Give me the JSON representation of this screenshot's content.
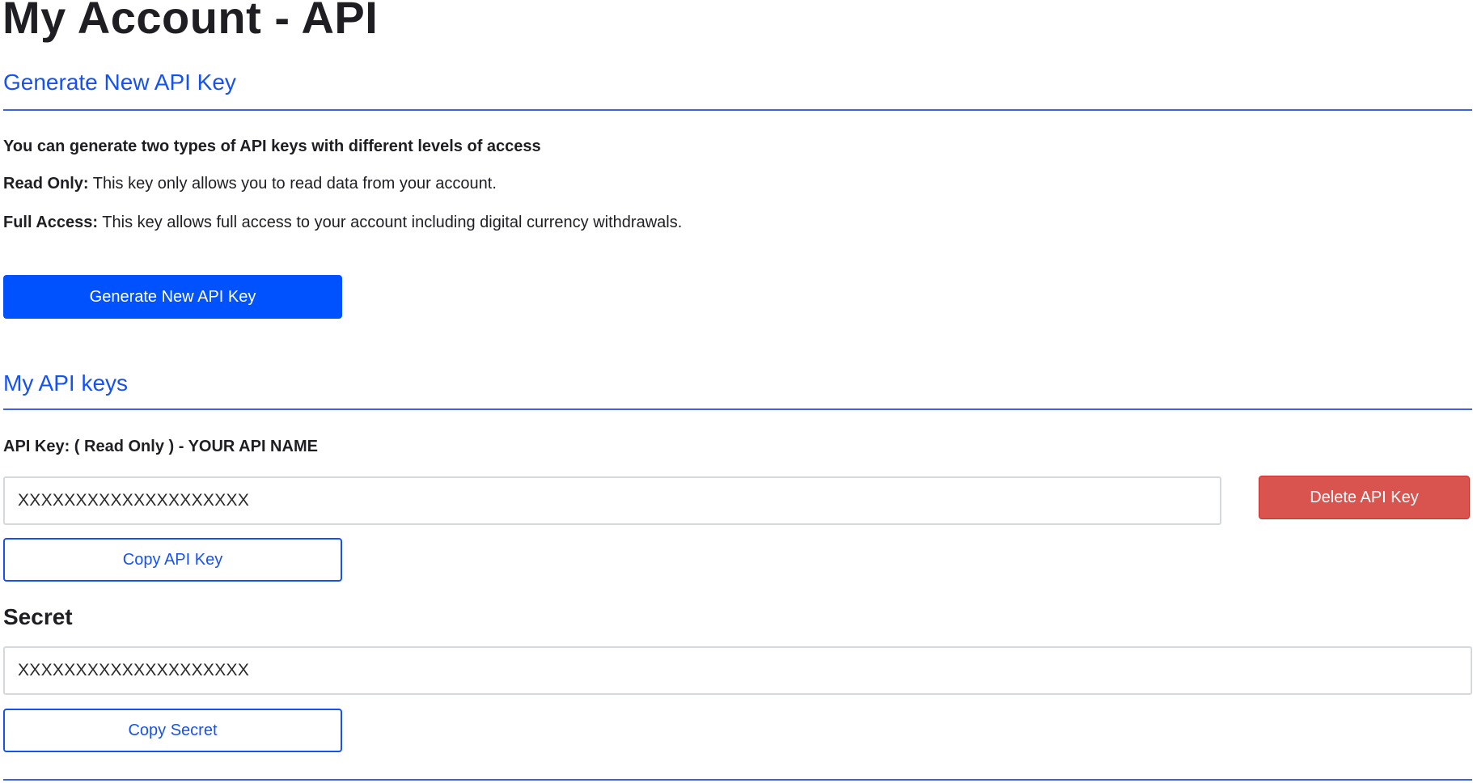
{
  "page": {
    "title": "My Account - API"
  },
  "generate_section": {
    "heading": "Generate New API Key",
    "intro": "You can generate two types of API keys with different levels of access",
    "read_only": {
      "label": "Read Only:",
      "description": " This key only allows you to read data from your account."
    },
    "full_access": {
      "label": "Full Access:",
      "description": " This key allows full access to your account including digital currency withdrawals."
    },
    "generate_button_label": "Generate New API Key"
  },
  "keys_section": {
    "heading": "My API keys",
    "key_title": "API Key: ( Read Only ) - YOUR API NAME",
    "api_key_value": "XXXXXXXXXXXXXXXXXXXX",
    "delete_button_label": "Delete API Key",
    "copy_key_button_label": "Copy API Key",
    "secret_label": "Secret",
    "secret_value": "XXXXXXXXXXXXXXXXXXXX",
    "copy_secret_button_label": "Copy Secret"
  },
  "colors": {
    "accent": "#1652f0",
    "primary_button": "#0052ff",
    "danger_button": "#d9534f",
    "rule": "#3e63dd"
  }
}
